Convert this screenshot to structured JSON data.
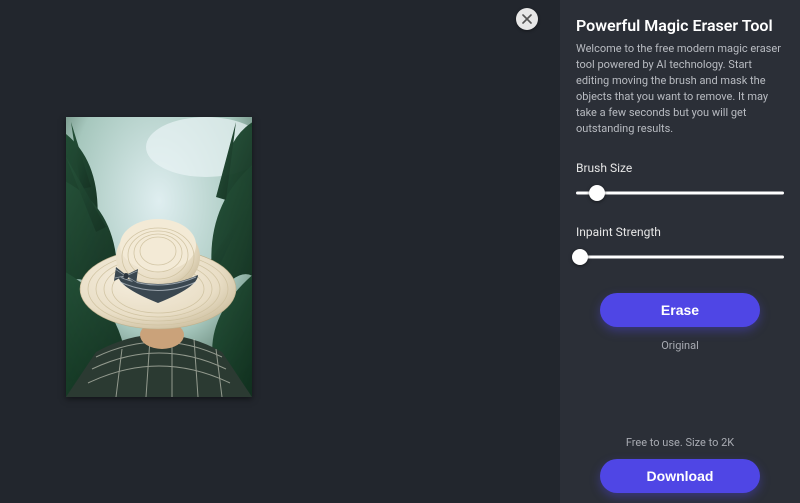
{
  "panel": {
    "title": "Powerful Magic Eraser Tool",
    "description": "Welcome to the free modern magic eraser tool powered by AI technology. Start editing moving the brush and mask the objects that you want to remove. It may take a few seconds but you will get outstanding results."
  },
  "controls": {
    "brush": {
      "label": "Brush Size",
      "value_pct": 10
    },
    "strength": {
      "label": "Inpaint Strength",
      "value_pct": 2
    }
  },
  "actions": {
    "erase_label": "Erase",
    "original_label": "Original",
    "download_label": "Download"
  },
  "footer": {
    "usage_note": "Free to use. Size to 2K"
  },
  "colors": {
    "accent": "#4f46e5",
    "bg_main": "#22262d",
    "bg_side": "#2b2f37"
  },
  "image": {
    "alt": "person-with-hat-photo"
  }
}
